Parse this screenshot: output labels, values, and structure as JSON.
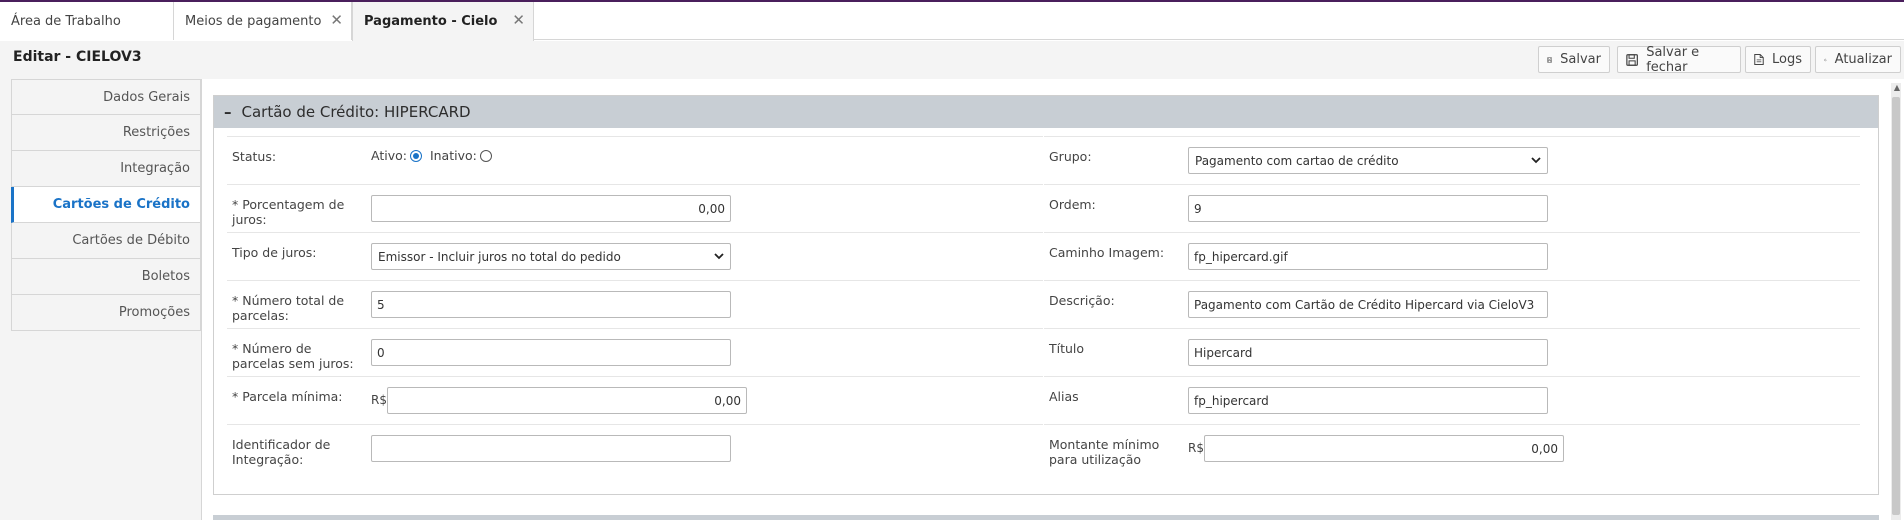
{
  "tabs": [
    {
      "label": "Área de Trabalho",
      "closable": false
    },
    {
      "label": "Meios de pagamento",
      "closable": true
    },
    {
      "label": "Pagamento - Cielo",
      "closable": true,
      "active": true
    }
  ],
  "header": {
    "title": "Editar - CIELOV3",
    "buttons": {
      "save": "Salvar",
      "save_close": "Salvar e fechar",
      "logs": "Logs",
      "refresh": "Atualizar"
    }
  },
  "sidebar": {
    "items": [
      {
        "label": "Dados Gerais"
      },
      {
        "label": "Restrições"
      },
      {
        "label": "Integração"
      },
      {
        "label": "Cartões de Crédito",
        "active": true
      },
      {
        "label": "Cartões de Débito"
      },
      {
        "label": "Boletos"
      },
      {
        "label": "Promoções"
      }
    ]
  },
  "panel": {
    "collapse_symbol": "–",
    "title": "Cartão de Crédito: HIPERCARD"
  },
  "form_left": {
    "status": {
      "label": "Status:",
      "active_label": "Ativo:",
      "inactive_label": "Inativo:",
      "value": "Ativo"
    },
    "interest_pct": {
      "label": "* Porcentagem de juros:",
      "value": "0,00"
    },
    "interest_type": {
      "label": "Tipo de juros:",
      "value": "Emissor - Incluir juros no total do pedido"
    },
    "total_installments": {
      "label": "* Número total de parcelas:",
      "value": "5"
    },
    "interest_free_installments": {
      "label": "* Número de parcelas sem juros:",
      "value": "0"
    },
    "min_installment": {
      "label": "* Parcela mínima:",
      "prefix": "R$",
      "value": "0,00"
    },
    "integration_id": {
      "label": "Identificador de Integração:",
      "value": ""
    }
  },
  "form_right": {
    "group": {
      "label": "Grupo:",
      "value": "Pagamento com cartao de crédito"
    },
    "order": {
      "label": "Ordem:",
      "value": "9"
    },
    "image_path": {
      "label": "Caminho Imagem:",
      "value": "fp_hipercard.gif"
    },
    "description": {
      "label": "Descrição:",
      "value": "Pagamento com Cartão de Crédito Hipercard via CieloV3"
    },
    "title": {
      "label": "Título",
      "value": "Hipercard"
    },
    "alias": {
      "label": "Alias",
      "value": "fp_hipercard"
    },
    "min_amount": {
      "label": "Montante mínimo para utilização",
      "prefix": "R$",
      "value": "0,00"
    }
  },
  "icons": {
    "tab_close": "close-icon",
    "save": "floppy-icon",
    "save_close": "floppy-icon",
    "logs": "document-icon",
    "refresh": "refresh-icon",
    "select": "chevron-down-icon"
  },
  "colors": {
    "accent": "#1a73c7",
    "top_bar": "#4a1f5c",
    "panel_header": "#c8ced4"
  }
}
